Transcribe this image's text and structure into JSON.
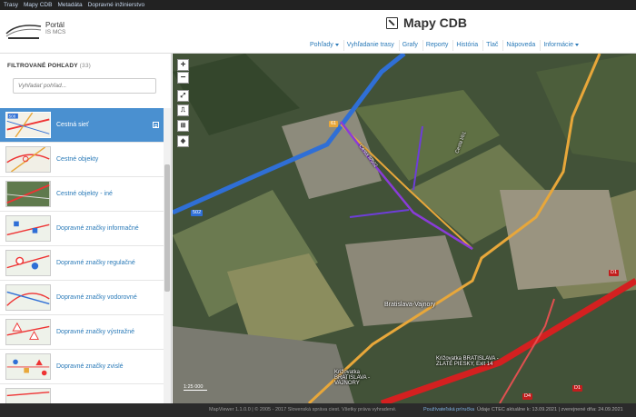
{
  "topnav": [
    "Trasy",
    "Mapy CDB",
    "Metadáta",
    "Dopravné inžinierstvo"
  ],
  "header": {
    "portal_title": "Portál",
    "portal_subtitle": "IS MCS",
    "app_title": "Mapy CDB",
    "menu": [
      {
        "label": "Pohľady",
        "dropdown": true
      },
      {
        "label": "Vyhľadanie trasy",
        "dropdown": false
      },
      {
        "label": "Grafy",
        "dropdown": false
      },
      {
        "label": "Reporty",
        "dropdown": false
      },
      {
        "label": "História",
        "dropdown": false
      },
      {
        "label": "Tlač",
        "dropdown": false
      },
      {
        "label": "Nápoveda",
        "dropdown": false
      },
      {
        "label": "Informácie",
        "dropdown": true
      }
    ]
  },
  "sidebar": {
    "heading": "FILTROVANÉ POHĽADY",
    "count": "(33)",
    "search_placeholder": "Vyhľadať pohľad...",
    "items": [
      {
        "label": "Cestná sieť",
        "active": true,
        "thumb": "network",
        "badge": "508"
      },
      {
        "label": "Cestné objekty",
        "active": false,
        "thumb": "objects"
      },
      {
        "label": "Cestné objekty - iné",
        "active": false,
        "thumb": "objects-other"
      },
      {
        "label": "Dopravné značky informačné",
        "active": false,
        "thumb": "signs-info"
      },
      {
        "label": "Dopravné značky regulačné",
        "active": false,
        "thumb": "signs-reg"
      },
      {
        "label": "Dopravné značky vodorovné",
        "active": false,
        "thumb": "signs-horiz"
      },
      {
        "label": "Dopravné značky výstražné",
        "active": false,
        "thumb": "signs-warn"
      },
      {
        "label": "Dopravné značky zvislé",
        "active": false,
        "thumb": "signs-vert"
      },
      {
        "label": "",
        "active": false,
        "thumb": "partial"
      }
    ]
  },
  "map": {
    "zoom_in": "+",
    "zoom_out": "−",
    "scale": "1:25 000",
    "labels": {
      "town": "Bratislava-Vajnory",
      "junction1": "Križovatka BRATISLAVA - ZLATÉ PIESKY, Exit 14",
      "junction2": "Križovatka BRATISLAVA - VAJNORY",
      "road1": "Cesta II/502",
      "road2": "Cesta I/61"
    },
    "road_numbers": [
      "502",
      "D1",
      "D1",
      "D4",
      "61"
    ]
  },
  "footer": {
    "copyright": "MapViewer 1.1.0.0 | © 2005 - 2017 Slovenská správa ciest. Všetky práva vyhradené.",
    "guide": "Používateľská príručka",
    "data_status": "Údaje CTEC aktuálne k: 13.09.2021 | zverejnené dňa: 24.09.2021"
  },
  "colors": {
    "accent": "#4a90d0",
    "link": "#2a7ab8",
    "road_red": "#d42020",
    "road_blue": "#2f6fd6",
    "road_yellow": "#e8a73a",
    "route_purple": "#8a3cd8"
  }
}
